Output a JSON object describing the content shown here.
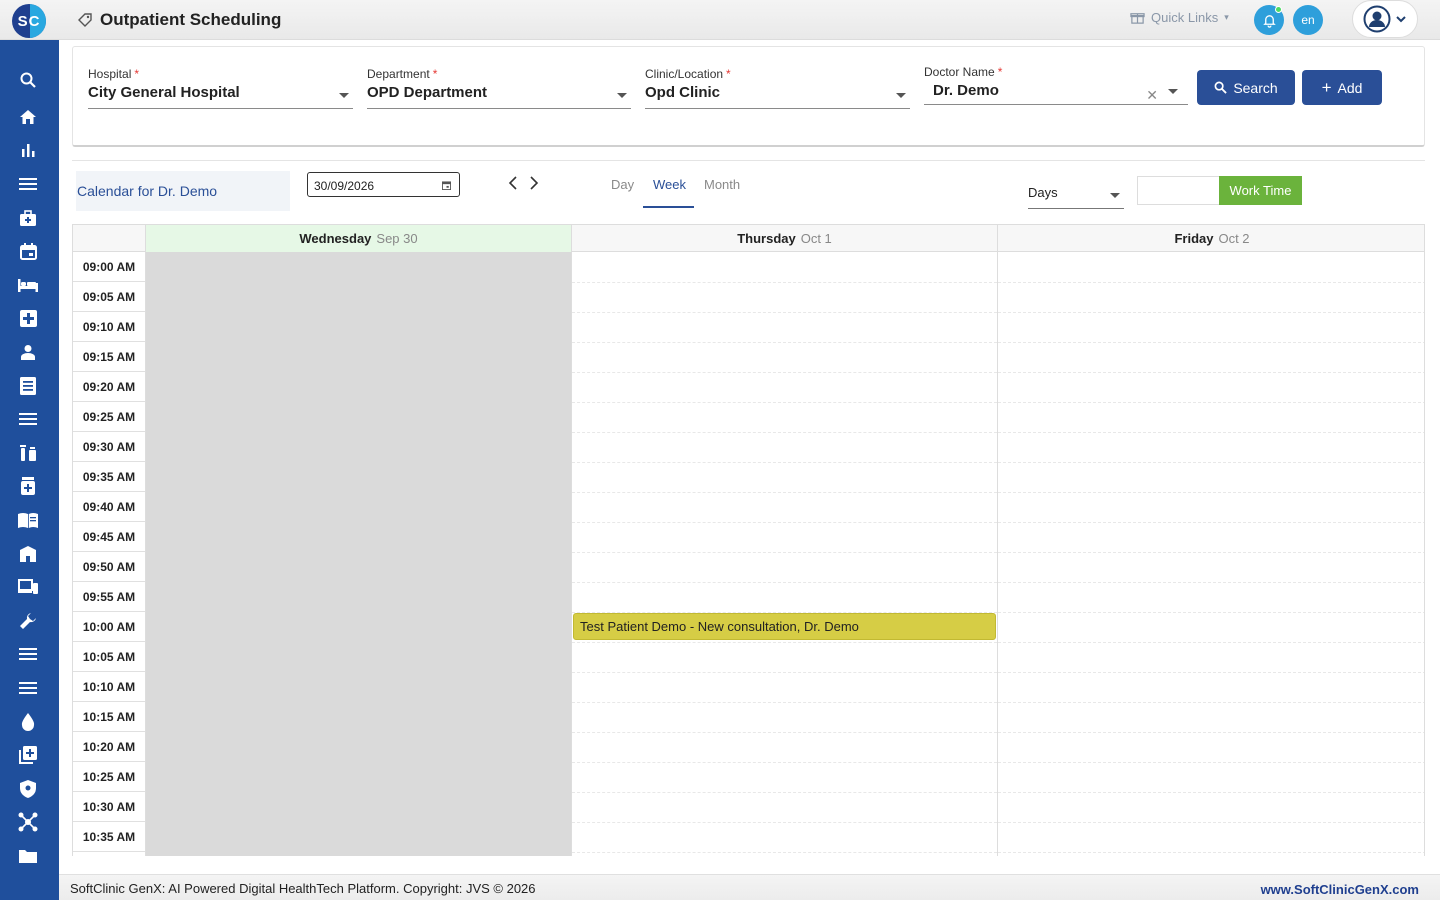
{
  "app": {
    "logo_text": "SC",
    "title": "Outpatient Scheduling",
    "quick_links": "Quick Links",
    "language": "en"
  },
  "filters": {
    "hospital": {
      "label": "Hospital",
      "value": "City General Hospital"
    },
    "department": {
      "label": "Department",
      "value": "OPD Department"
    },
    "clinic": {
      "label": "Clinic/Location",
      "value": "Opd Clinic"
    },
    "doctor": {
      "label": "Doctor Name",
      "value": "Dr. Demo"
    },
    "required_mark": "*",
    "search_label": "Search",
    "add_label": "Add"
  },
  "calendar": {
    "title": "Calendar for Dr. Demo",
    "date": "30/09/2026",
    "views": [
      "Day",
      "Week",
      "Month"
    ],
    "active_view": "Week",
    "range_select": "Days",
    "work_time_label": "Work Time",
    "days": [
      {
        "name": "Wednesday",
        "date": "Sep 30"
      },
      {
        "name": "Thursday",
        "date": "Oct 1"
      },
      {
        "name": "Friday",
        "date": "Oct 2"
      }
    ],
    "slots": [
      "09:00 AM",
      "09:05 AM",
      "09:10 AM",
      "09:15 AM",
      "09:20 AM",
      "09:25 AM",
      "09:30 AM",
      "09:35 AM",
      "09:40 AM",
      "09:45 AM",
      "09:50 AM",
      "09:55 AM",
      "10:00 AM",
      "10:05 AM",
      "10:10 AM",
      "10:15 AM",
      "10:20 AM",
      "10:25 AM",
      "10:30 AM",
      "10:35 AM"
    ],
    "event": {
      "text": "Test Patient Demo - New consultation, Dr. Demo",
      "color": "#d6cd45"
    }
  },
  "footer": {
    "copyright": "SoftClinic GenX: AI Powered Digital HealthTech Platform. Copyright: JVS © 2026",
    "website": "www.SoftClinicGenX.com"
  },
  "sidebar_icons": [
    "search-icon",
    "home-icon",
    "bar-chart-icon",
    "menu-icon",
    "medical-bag-icon",
    "calendar-icon",
    "bed-icon",
    "medical-cross-icon",
    "person-icon",
    "document-icon",
    "menu-icon",
    "pharmacy-icon",
    "medicine-icon",
    "book-icon",
    "building-icon",
    "devices-icon",
    "wrench-icon",
    "menu-icon",
    "menu-icon",
    "blood-drop-icon",
    "add-box-icon",
    "shield-icon",
    "network-icon",
    "folder-icon"
  ],
  "colors": {
    "primary": "#2a4f97",
    "sidebar": "#1f4f9c",
    "accent": "#2e9fdb",
    "work_time": "#6bb33c",
    "blocked": "#dadada"
  }
}
